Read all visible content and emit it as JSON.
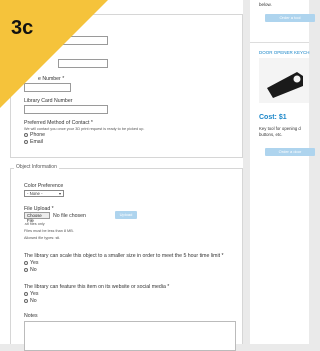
{
  "badge": "3c",
  "contact": {
    "phone_label_suffix": "e Number *",
    "library_card_label": "Library Card Number",
    "method_label": "Preferred Method of Contact *",
    "method_help": "We will contact you once your 3D print request is ready to be picked up.",
    "options": [
      "Phone",
      "Email"
    ]
  },
  "object": {
    "legend": "Object Information",
    "color_label": "Color Preference",
    "color_value": "- None -",
    "file_label": "File Upload *",
    "choose_file": "Choose File",
    "no_file": "No file chosen",
    "upload": "Upload",
    "file_help": [
      ".stl files only",
      "Files must be less than 8 MB.",
      "Allowed file types: stl."
    ],
    "scale_question": "The library can scale this object to a smaller size in order to meet the 5 hour time limit *",
    "feature_question": "The library can feature this item on its website or social media *",
    "yes_no": [
      "Yes",
      "No"
    ],
    "notes_label": "Notes"
  },
  "sidebar": {
    "top_text": "below.",
    "order_btn_1": "Order a tool",
    "section_title": "DOOR OPENER KEYCH",
    "cost": "Cost: $1",
    "desc_1": "Key tool for opening d",
    "desc_2": "buttons, etc.",
    "order_btn_2": "Order a door"
  },
  "colors": {
    "accent": "#f5c33b",
    "link": "#1a86c8",
    "button": "#aed4ee"
  }
}
